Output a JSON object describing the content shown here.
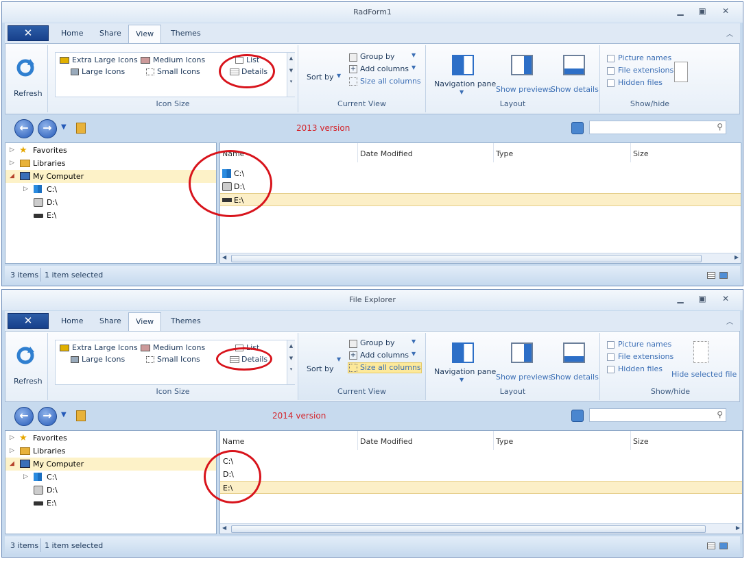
{
  "windows": [
    {
      "title": "RadForm1",
      "tabs": [
        "Home",
        "Share",
        "View",
        "Themes"
      ],
      "selected_tab": "View",
      "ribbon": {
        "refresh_label": "Refresh",
        "icon_size": {
          "items": [
            "Extra Large Icons",
            "Medium Icons",
            "List",
            "Large Icons",
            "Small Icons",
            "Details"
          ],
          "group_label": "Icon Size"
        },
        "current_view": {
          "sort_by": "Sort by",
          "group_by": "Group by",
          "add_columns": "Add columns",
          "size_all_columns": "Size all columns",
          "group_label": "Current View"
        },
        "layout": {
          "navigation_pane": "Navigation pane",
          "show_previews": "Show previews",
          "show_details": "Show details",
          "group_label": "Layout"
        },
        "show_hide": {
          "picture_names": "Picture names",
          "file_extensions": "File extensions",
          "hidden_files": "Hidden files",
          "hide_selected": "",
          "group_label": "Show/hide"
        }
      },
      "version_label": "2013 version",
      "tree": [
        {
          "label": "Favorites",
          "icon": "star-icon"
        },
        {
          "label": "Libraries",
          "icon": "library-icon"
        },
        {
          "label": "My Computer",
          "icon": "computer-icon",
          "selected": true
        },
        {
          "label": "C:\\",
          "icon": "windows-drive-icon"
        },
        {
          "label": "D:\\",
          "icon": "dvd-drive-icon"
        },
        {
          "label": "E:\\",
          "icon": "removable-drive-icon"
        }
      ],
      "columns": [
        "Name",
        "Date Modified",
        "Type",
        "Size"
      ],
      "rows": [
        "C:\\",
        "D:\\",
        "E:\\"
      ],
      "status": {
        "items": "3 items",
        "selected": "1 item selected"
      }
    },
    {
      "title": "File Explorer",
      "tabs": [
        "Home",
        "Share",
        "View",
        "Themes"
      ],
      "selected_tab": "View",
      "ribbon": {
        "refresh_label": "Refresh",
        "icon_size": {
          "items": [
            "Extra Large Icons",
            "Medium Icons",
            "List",
            "Large Icons",
            "Small Icons",
            "Details"
          ],
          "group_label": "Icon Size"
        },
        "current_view": {
          "sort_by": "Sort by",
          "group_by": "Group by",
          "add_columns": "Add columns",
          "size_all_columns": "Size all columns",
          "group_label": "Current View"
        },
        "layout": {
          "navigation_pane": "Navigation pane",
          "show_previews": "Show previews",
          "show_details": "Show details",
          "group_label": "Layout"
        },
        "show_hide": {
          "picture_names": "Picture names",
          "file_extensions": "File extensions",
          "hidden_files": "Hidden files",
          "hide_selected": "Hide selected file",
          "group_label": "Show/hide"
        }
      },
      "version_label": "2014 version",
      "tree": [
        {
          "label": "Favorites",
          "icon": "star-icon"
        },
        {
          "label": "Libraries",
          "icon": "library-icon"
        },
        {
          "label": "My Computer",
          "icon": "computer-icon",
          "selected": true
        },
        {
          "label": "C:\\",
          "icon": "windows-drive-icon"
        },
        {
          "label": "D:\\",
          "icon": "dvd-drive-icon"
        },
        {
          "label": "E:\\",
          "icon": "removable-drive-icon"
        }
      ],
      "columns": [
        "Name",
        "Date Modified",
        "Type",
        "Size"
      ],
      "rows": [
        "C:\\",
        "D:\\",
        "E:\\"
      ],
      "status": {
        "items": "3 items",
        "selected": "1 item selected"
      }
    }
  ],
  "colors": {
    "accent": "#2459b8",
    "annotation": "#d8141c",
    "version_text": "#d4242b",
    "selection": "#fcefc7"
  }
}
